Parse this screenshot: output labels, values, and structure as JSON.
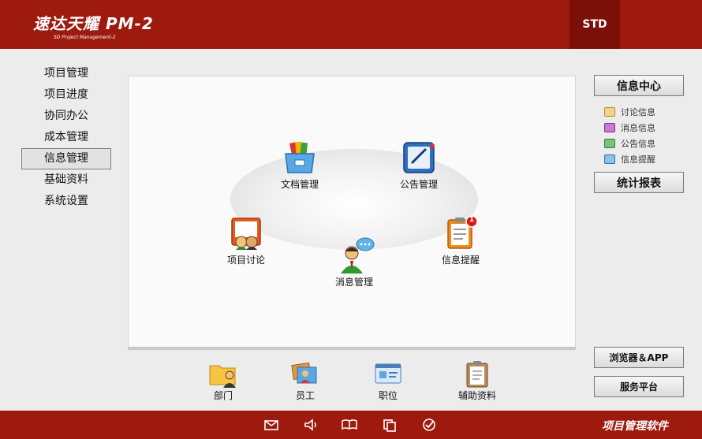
{
  "header": {
    "logo_main": "速达天耀 PM-2",
    "logo_sub": "SD Project Management-2",
    "edition": "STD"
  },
  "nav": {
    "items": [
      "项目管理",
      "项目进度",
      "协同办公",
      "成本管理",
      "信息管理",
      "基础资料",
      "系统设置"
    ],
    "active_index": 4
  },
  "modules": {
    "doc": "文档管理",
    "notice": "公告管理",
    "discuss": "项目讨论",
    "reminder": "信息提醒",
    "message": "消息管理",
    "reminder_badge": "1"
  },
  "right": {
    "info_center": "信息中心",
    "messages": [
      "讨论信息",
      "消息信息",
      "公告信息",
      "信息提醒"
    ],
    "stats": "统计报表",
    "browser_app": "浏览器＆APP",
    "service": "服务平台"
  },
  "bottom": {
    "items": [
      "部门",
      "员工",
      "职位",
      "辅助资料"
    ]
  },
  "footer": {
    "text": "项目管理软件",
    "icons": [
      "mail-icon",
      "speaker-icon",
      "book-icon",
      "copy-icon",
      "check-icon"
    ]
  },
  "colors": {
    "brand_red": "#9e1a0f",
    "dark_red": "#7a1008"
  }
}
